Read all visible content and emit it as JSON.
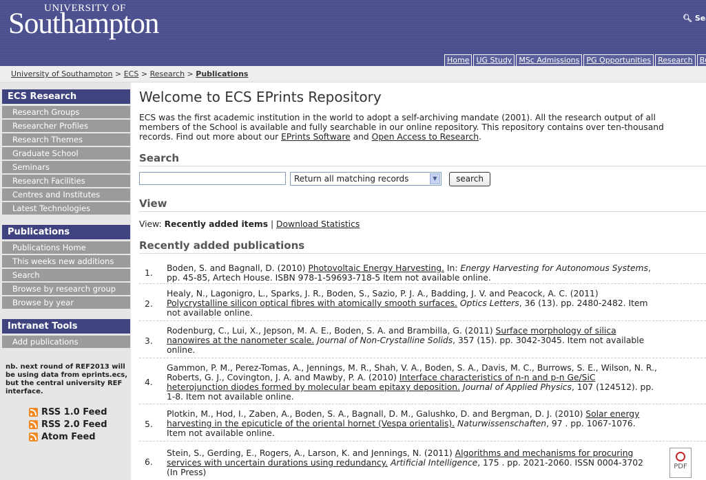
{
  "header": {
    "logo_top": "UNIVERSITY OF",
    "logo_main": "Southampton",
    "search_label": "Sea",
    "nav": [
      "Home",
      "UG Study",
      "MSc Admissions",
      "PG Opportunities",
      "Research",
      "Bu"
    ]
  },
  "breadcrumb": {
    "items": [
      "University of Southampton",
      "ECS",
      "Research"
    ],
    "separator": ">",
    "current": "Publications"
  },
  "sidebar": {
    "sections": [
      {
        "title": "ECS Research",
        "items": [
          "Research Groups",
          "Researcher Profiles",
          "Research Themes",
          "Graduate School",
          "Seminars",
          "Research Facilities",
          "Centres and Institutes",
          "Latest Technologies"
        ]
      },
      {
        "title": "Publications",
        "items": [
          "Publications Home",
          "This weeks new additions",
          "Search",
          "Browse by research group",
          "Browse by year"
        ]
      },
      {
        "title": "Intranet Tools",
        "items": [
          "Add publications"
        ]
      }
    ],
    "note": "nb. next round of REF2013 will be using data from eprints.ecs, but the central university REF interface.",
    "feeds": [
      "RSS 1.0 Feed",
      "RSS 2.0 Feed",
      "Atom Feed"
    ]
  },
  "main": {
    "title": "Welcome to ECS EPrints Repository",
    "intro_text": "ECS was the first academic institution in the world to adopt a self-archiving mandate (2001). All the research output of all members of the School is available and fully searchable in our online repository. This repository contains over ten-thousand records. Find out more about our ",
    "intro_link1": "EPrints Software",
    "intro_and": " and ",
    "intro_link2": "Open Access to Research",
    "intro_end": ".",
    "search_heading": "Search",
    "search_value": "",
    "search_option": "Return all matching records",
    "search_button": "search",
    "view_heading": "View",
    "view_prefix": "View: ",
    "view_current": "Recently added items",
    "view_sep": " | ",
    "view_link": "Download Statistics",
    "recent_heading": "Recently added publications",
    "publications": [
      {
        "num": "1.",
        "authors": "Boden, S. and Bagnall, D. (2010) ",
        "title": "Photovoltaic Energy Harvesting.",
        "mid": " In: ",
        "venue": "Energy Harvesting for Autonomous Systems",
        "rest": ", pp. 45-85, Artech House. ISBN 978-1-59693-718-5 Item not available online."
      },
      {
        "num": "2.",
        "authors": "Healy, N., Lagonigro, L., Sparks, J. R., Boden, S., Sazio, P. J. A., Badding, J. V. and Peacock, A. C. (2011) ",
        "title": "Polycrystalline silicon optical fibres with atomically smooth surfaces.",
        "mid": " ",
        "venue": "Optics Letters",
        "rest": ", 36 (13). pp. 2480-2482. Item not available online."
      },
      {
        "num": "3.",
        "authors": "Rodenburg, C., Lui, X., Jepson, M. A. E., Boden, S. A. and Brambilla, G. (2011) ",
        "title": "Surface morphology of silica nanowires at the nanometer scale.",
        "mid": " ",
        "venue": "Journal of Non-Crystalline Solids",
        "rest": ", 357 (15). pp. 3042-3045. Item not available online."
      },
      {
        "num": "4.",
        "authors": "Gammon, P. M., Perez-Tomas, A., Jennings, M. R., Shah, V. A., Boden, S. A., Davis, M. C., Burrows, S. E., Wilson, N. R., Roberts, G. J., Covington, J. A. and Mawby, P. A. (2010) ",
        "title": "Interface characteristics of n-n and p-n Ge/SiC heterojunction diodes formed by molecular beam epitaxy deposition.",
        "mid": " ",
        "venue": "Journal of Applied Physics",
        "rest": ", 107 (124512). pp. 1-8. Item not available online."
      },
      {
        "num": "5.",
        "authors": "Plotkin, M., Hod, I., Zaben, A., Boden, S. A., Bagnall, D. M., Galushko, D. and Bergman, D. J. (2010) ",
        "title": "Solar energy harvesting in the epicuticle of the oriental hornet (Vespa orientalis).",
        "mid": " ",
        "venue": "Naturwissenschaften",
        "rest": ", 97 . pp. 1067-1076. Item not available online."
      },
      {
        "num": "6.",
        "authors": "Stein, S., Gerding, E., Rogers, A., Larson, K. and Jennings, N. (2011) ",
        "title": "Algorithms and mechanisms for procuring services with uncertain durations using redundancy.",
        "mid": " ",
        "venue": "Artificial Intelligence",
        "rest": ", 175 . pp. 2021-2060. ISSN 0004-3702 (In Press)"
      }
    ],
    "pdf_label": "PDF"
  }
}
